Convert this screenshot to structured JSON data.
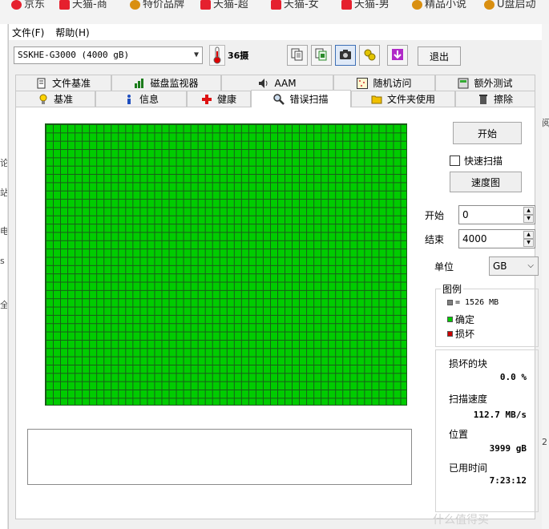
{
  "background": {
    "bookmarks": [
      {
        "label": "京东",
        "icon": "jd-icon"
      },
      {
        "label": "天猫-商",
        "icon": "tmall-icon"
      },
      {
        "label": "特价品牌",
        "icon": "tmall-icon"
      },
      {
        "label": "天猫-超",
        "icon": "tmall-icon"
      },
      {
        "label": "天猫-女",
        "icon": "tmall-icon"
      },
      {
        "label": "天猫-男",
        "icon": "tmall-icon"
      },
      {
        "label": "精品小说",
        "icon": "book-icon"
      },
      {
        "label": "U盘启动",
        "icon": "usb-icon"
      }
    ],
    "left_fragments": [
      "论",
      "站",
      "电",
      "s",
      "全"
    ],
    "right_fragments": [
      "阅",
      "2"
    ],
    "watermark": "什么值得买"
  },
  "menu": {
    "file": "文件(F)",
    "help": "帮助(H)"
  },
  "toolbar": {
    "drive": "SSKHE-G3000 (4000 gB)",
    "temperature": "36摄",
    "exit": "退出"
  },
  "tabs_top": [
    "文件基准",
    "磁盘监视器",
    "AAM",
    "随机访问",
    "额外测试"
  ],
  "tabs_bottom": [
    "基准",
    "信息",
    "健康",
    "错误扫描",
    "文件夹使用",
    "擦除"
  ],
  "active_tab": "错误扫描",
  "controls": {
    "start_button": "开始",
    "quick_scan": "快速扫描",
    "quick_scan_checked": false,
    "speed_button": "速度图",
    "start_label": "开始",
    "start_value": "0",
    "end_label": "结束",
    "end_value": "4000",
    "unit_label": "单位",
    "unit_value": "GB"
  },
  "legend": {
    "title": "图例",
    "block_size": "= 1526 MB",
    "ok": "确定",
    "damaged": "损坏"
  },
  "stats": {
    "damaged_blocks_label": "损坏的块",
    "damaged_blocks_value": "0.0 %",
    "scan_speed_label": "扫描速度",
    "scan_speed_value": "112.7 MB/s",
    "position_label": "位置",
    "position_value": "3999 gB",
    "elapsed_label": "已用时间",
    "elapsed_value": "7:23:12"
  },
  "colors": {
    "grid_ok": "#00cc00",
    "grid_lines": "#1a5a1a",
    "legend_block": "#808080",
    "legend_ok": "#00cc00",
    "legend_damaged": "#cc0000"
  }
}
